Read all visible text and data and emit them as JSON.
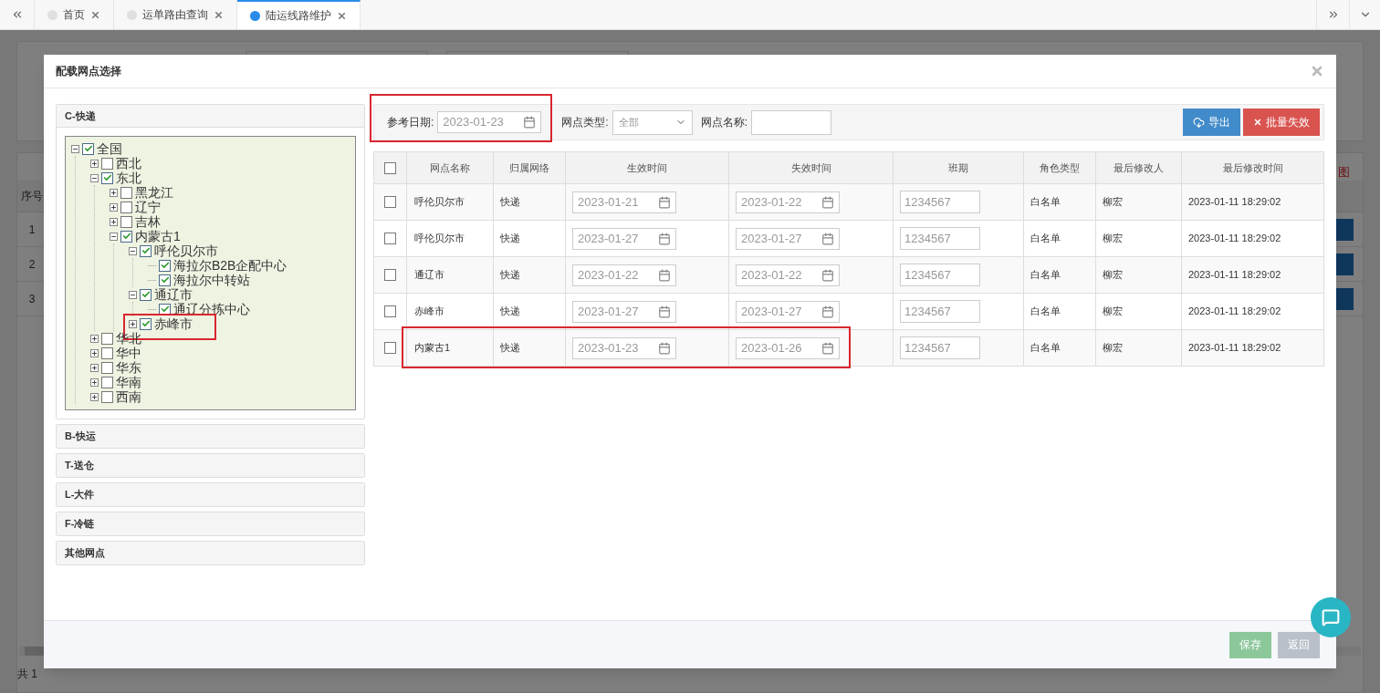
{
  "tabs": [
    {
      "label": "首页",
      "selected": false
    },
    {
      "label": "运单路由查询",
      "selected": false
    },
    {
      "label": "陆运线路维护",
      "selected": true
    }
  ],
  "background_page": {
    "extra_mark": "图",
    "table": {
      "columns": [
        "序号"
      ],
      "rows": [
        "1",
        "2",
        "3"
      ]
    },
    "pager": "共 1"
  },
  "dialog": {
    "title": "配载网点选择",
    "sections": [
      {
        "label": "C-快递",
        "expanded": true
      },
      {
        "label": "B-快运",
        "expanded": false
      },
      {
        "label": "T-送仓",
        "expanded": false
      },
      {
        "label": "L-大件",
        "expanded": false
      },
      {
        "label": "F-冷链",
        "expanded": false
      },
      {
        "label": "其他网点",
        "expanded": false
      }
    ],
    "tree": [
      {
        "label": "全国",
        "kind": "branch",
        "expanded": true,
        "checked": true,
        "children": [
          {
            "label": "西北",
            "kind": "branch",
            "expanded": false,
            "checked": false,
            "highlighted": false
          },
          {
            "label": "东北",
            "kind": "branch",
            "expanded": true,
            "checked": true,
            "children": [
              {
                "label": "黑龙江",
                "kind": "branch",
                "expanded": false,
                "checked": false,
                "highlighted": false
              },
              {
                "label": "辽宁",
                "kind": "branch",
                "expanded": false,
                "checked": false,
                "highlighted": false
              },
              {
                "label": "吉林",
                "kind": "branch",
                "expanded": false,
                "checked": false,
                "highlighted": false
              },
              {
                "label": "内蒙古1",
                "kind": "branch",
                "expanded": true,
                "checked": true,
                "children": [
                  {
                    "label": "呼伦贝尔市",
                    "kind": "branch",
                    "expanded": true,
                    "checked": true,
                    "children": [
                      {
                        "label": "海拉尔B2B企配中心",
                        "kind": "leaf",
                        "checked": true,
                        "highlighted": false
                      },
                      {
                        "label": "海拉尔中转站",
                        "kind": "leaf",
                        "checked": true,
                        "highlighted": false
                      }
                    ]
                  },
                  {
                    "label": "通辽市",
                    "kind": "branch",
                    "expanded": true,
                    "checked": true,
                    "children": [
                      {
                        "label": "通辽分拣中心",
                        "kind": "leaf",
                        "checked": true,
                        "highlighted": false
                      }
                    ]
                  },
                  {
                    "label": "赤峰市",
                    "kind": "branch",
                    "expanded": false,
                    "checked": true,
                    "highlighted": true
                  }
                ]
              }
            ]
          },
          {
            "label": "华北",
            "kind": "branch",
            "expanded": false,
            "checked": false,
            "highlighted": false
          },
          {
            "label": "华中",
            "kind": "branch",
            "expanded": false,
            "checked": false,
            "highlighted": false
          },
          {
            "label": "华东",
            "kind": "branch",
            "expanded": false,
            "checked": false,
            "highlighted": false
          },
          {
            "label": "华南",
            "kind": "branch",
            "expanded": false,
            "checked": false,
            "highlighted": false
          },
          {
            "label": "西南",
            "kind": "branch",
            "expanded": false,
            "checked": false,
            "highlighted": false
          }
        ]
      }
    ],
    "filters": {
      "ref_date_label": "参考日期:",
      "ref_date": "2023-01-23",
      "ref_date_highlighted": true,
      "type_label": "网点类型:",
      "type_value": "全部",
      "name_label": "网点名称:"
    },
    "buttons": [
      {
        "label": "导出",
        "kind": "export"
      },
      {
        "label": "批量失效",
        "kind": "invalidate"
      }
    ],
    "table": {
      "all_checked": false,
      "columns": [
        "网点名称",
        "归属网络",
        "生效时间",
        "失效时间",
        "班期",
        "角色类型",
        "最后修改人",
        "最后修改时间"
      ],
      "rows": [
        {
          "checked": false,
          "name": "呼伦贝尔市",
          "network": "快递",
          "start": "2023-01-21",
          "end": "2023-01-22",
          "schedule": "1234567",
          "role": "白名单",
          "modifier": "柳宏",
          "modified": "2023-01-11 18:29:02"
        },
        {
          "checked": false,
          "name": "呼伦贝尔市",
          "network": "快递",
          "start": "2023-01-27",
          "end": "2023-01-27",
          "schedule": "1234567",
          "role": "白名单",
          "modifier": "柳宏",
          "modified": "2023-01-11 18:29:02"
        },
        {
          "checked": false,
          "name": "通辽市",
          "network": "快递",
          "start": "2023-01-22",
          "end": "2023-01-22",
          "schedule": "1234567",
          "role": "白名单",
          "modifier": "柳宏",
          "modified": "2023-01-11 18:29:02"
        },
        {
          "checked": false,
          "name": "赤峰市",
          "network": "快递",
          "start": "2023-01-27",
          "end": "2023-01-27",
          "schedule": "1234567",
          "role": "白名单",
          "modifier": "柳宏",
          "modified": "2023-01-11 18:29:02"
        },
        {
          "checked": false,
          "highlighted": true,
          "name": "内蒙古1",
          "network": "快递",
          "start": "2023-01-23",
          "end": "2023-01-26",
          "schedule": "1234567",
          "role": "白名单",
          "modifier": "柳宏",
          "modified": "2023-01-11 18:29:02"
        }
      ]
    },
    "footer_buttons": [
      {
        "label": "保存",
        "kind": "save"
      },
      {
        "label": "返回",
        "kind": "back"
      }
    ]
  }
}
